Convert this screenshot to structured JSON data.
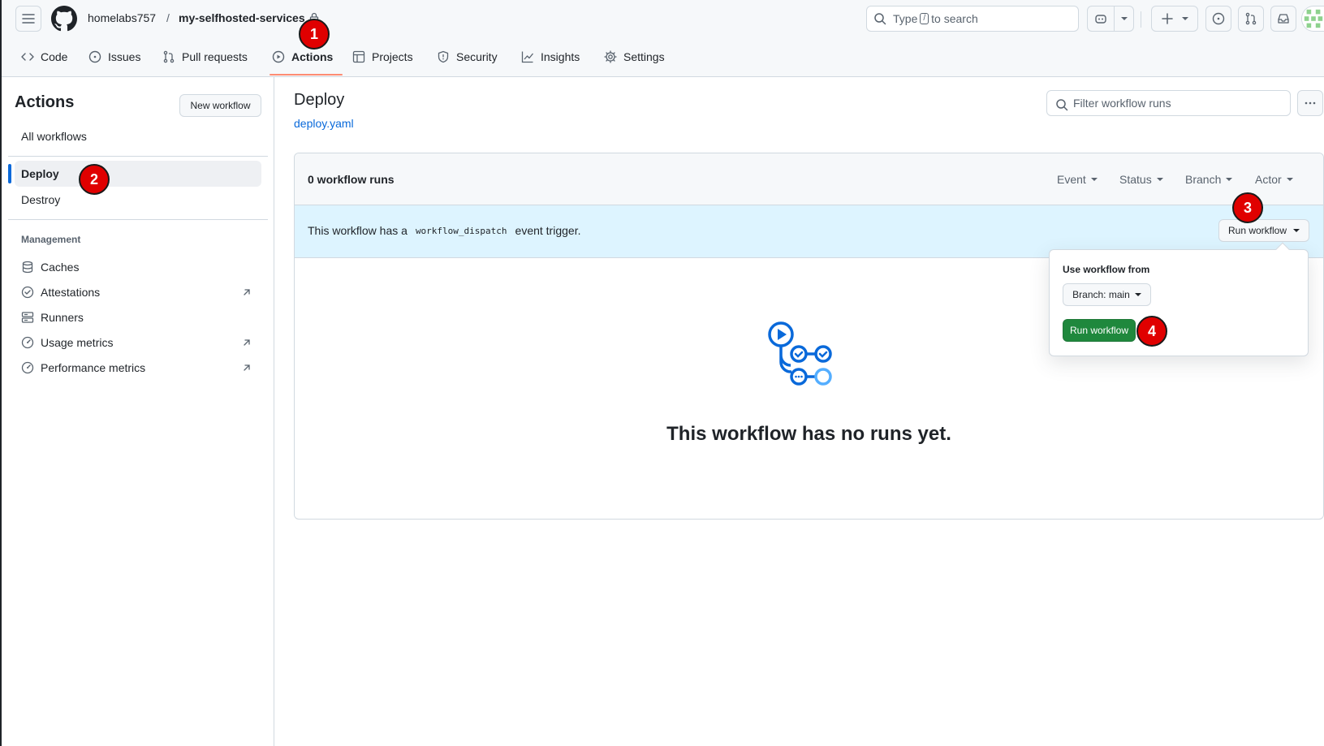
{
  "header": {
    "repo_owner": "homelabs757",
    "repo_separator": "/",
    "repo_name": "my-selfhosted-services",
    "search_prefix": "Type",
    "search_key": "/",
    "search_suffix": "to search",
    "icons": [
      "hamburger-icon",
      "github-logo-icon",
      "lock-icon",
      "search-icon",
      "copilot-icon",
      "plus-icon",
      "issue-icon",
      "pull-request-icon",
      "inbox-icon",
      "avatar"
    ]
  },
  "tabs": [
    {
      "label": "Code",
      "icon": "code-icon"
    },
    {
      "label": "Issues",
      "icon": "issue-icon"
    },
    {
      "label": "Pull requests",
      "icon": "pull-request-icon"
    },
    {
      "label": "Actions",
      "icon": "play-icon",
      "active": true
    },
    {
      "label": "Projects",
      "icon": "table-icon"
    },
    {
      "label": "Security",
      "icon": "shield-icon"
    },
    {
      "label": "Insights",
      "icon": "graph-icon"
    },
    {
      "label": "Settings",
      "icon": "gear-icon"
    }
  ],
  "sidebar": {
    "title": "Actions",
    "new_workflow": "New workflow",
    "all_workflows": "All workflows",
    "workflows": [
      {
        "label": "Deploy",
        "selected": true
      },
      {
        "label": "Destroy"
      }
    ],
    "management_title": "Management",
    "management": [
      {
        "label": "Caches",
        "icon": "database-icon"
      },
      {
        "label": "Attestations",
        "icon": "verified-icon",
        "external": true
      },
      {
        "label": "Runners",
        "icon": "server-icon"
      },
      {
        "label": "Usage metrics",
        "icon": "meter-icon",
        "external": true
      },
      {
        "label": "Performance metrics",
        "icon": "meter-icon",
        "external": true
      }
    ]
  },
  "main": {
    "title": "Deploy",
    "file": "deploy.yaml",
    "filter_placeholder": "Filter workflow runs",
    "runs_count": "0 workflow runs",
    "filters": [
      "Event",
      "Status",
      "Branch",
      "Actor"
    ],
    "dispatch_prefix": "This workflow has a",
    "dispatch_code": "workflow_dispatch",
    "dispatch_suffix": "event trigger.",
    "run_workflow": "Run workflow",
    "empty_title": "This workflow has no runs yet."
  },
  "popover": {
    "label": "Use workflow from",
    "branch": "Branch: main",
    "run_button": "Run workflow"
  },
  "markers": [
    "1",
    "2",
    "3",
    "4"
  ],
  "colors": {
    "accent": "#0969da",
    "tab_underline": "#fd8c73",
    "run_green": "#1f883d",
    "dispatch_bg": "#ddf4ff",
    "marker": "#e00000"
  }
}
